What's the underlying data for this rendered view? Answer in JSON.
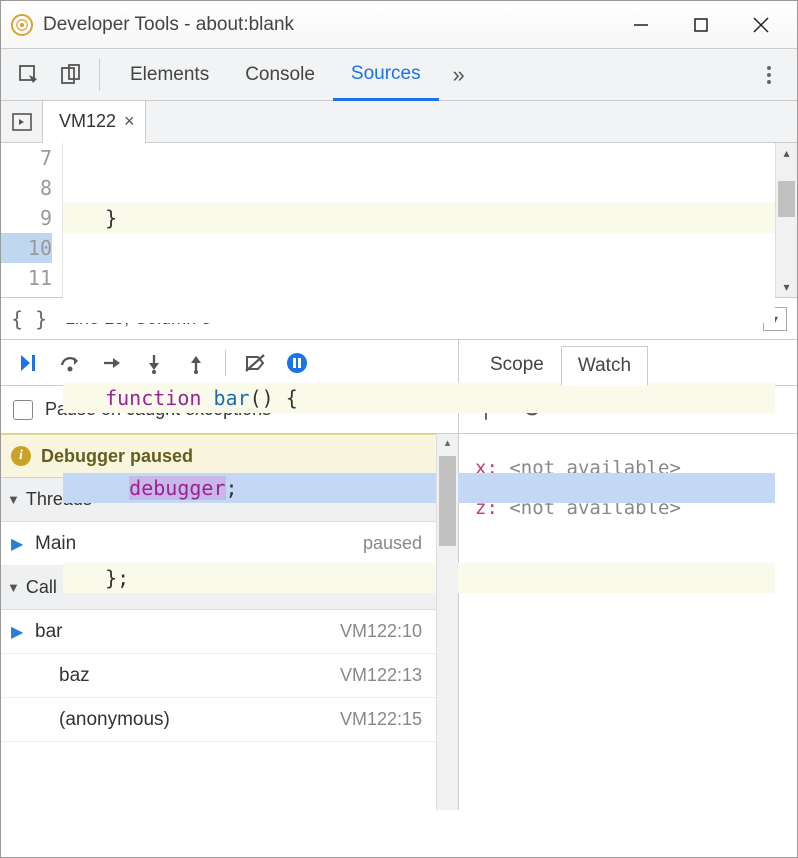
{
  "window": {
    "title": "Developer Tools - about:blank"
  },
  "toolbar": {
    "tabs": [
      "Elements",
      "Console",
      "Sources"
    ],
    "active_index": 2,
    "more_glyph": "»"
  },
  "file_tab": {
    "name": "VM122",
    "close": "×"
  },
  "code": {
    "line_numbers": [
      "7",
      "8",
      "9",
      "10",
      "11"
    ],
    "lines": [
      {
        "raw": "}",
        "bg": "hl0"
      },
      {
        "raw": "",
        "bg": "plain"
      },
      {
        "raw_html": "func_bar",
        "bg": "hl0"
      },
      {
        "raw_html": "debugger",
        "bg": "hl"
      },
      {
        "raw": "};",
        "bg": "hl0"
      }
    ],
    "func_kw": "function",
    "func_name": "bar",
    "func_rest": "() {",
    "debugger_kw": "debugger",
    "debugger_rest": ";",
    "highlight_line_index": 3
  },
  "cursor": {
    "text": "Line 10, Column 5"
  },
  "debug": {
    "pause_exceptions_label": "Pause on caught exceptions",
    "paused_banner": "Debugger paused",
    "sections": {
      "threads": {
        "title": "Threads",
        "items": [
          {
            "name": "Main",
            "meta": "paused",
            "active": true
          }
        ]
      },
      "callstack": {
        "title": "Call Stack",
        "items": [
          {
            "name": "bar",
            "meta": "VM122:10",
            "active": true
          },
          {
            "name": "baz",
            "meta": "VM122:13",
            "active": false
          },
          {
            "name": "(anonymous)",
            "meta": "VM122:15",
            "active": false
          }
        ]
      }
    }
  },
  "right": {
    "tabs": [
      "Scope",
      "Watch"
    ],
    "active_index": 1,
    "watch": [
      {
        "name": "x",
        "value": "<not available>"
      },
      {
        "name": "z",
        "value": "<not available>"
      }
    ]
  }
}
